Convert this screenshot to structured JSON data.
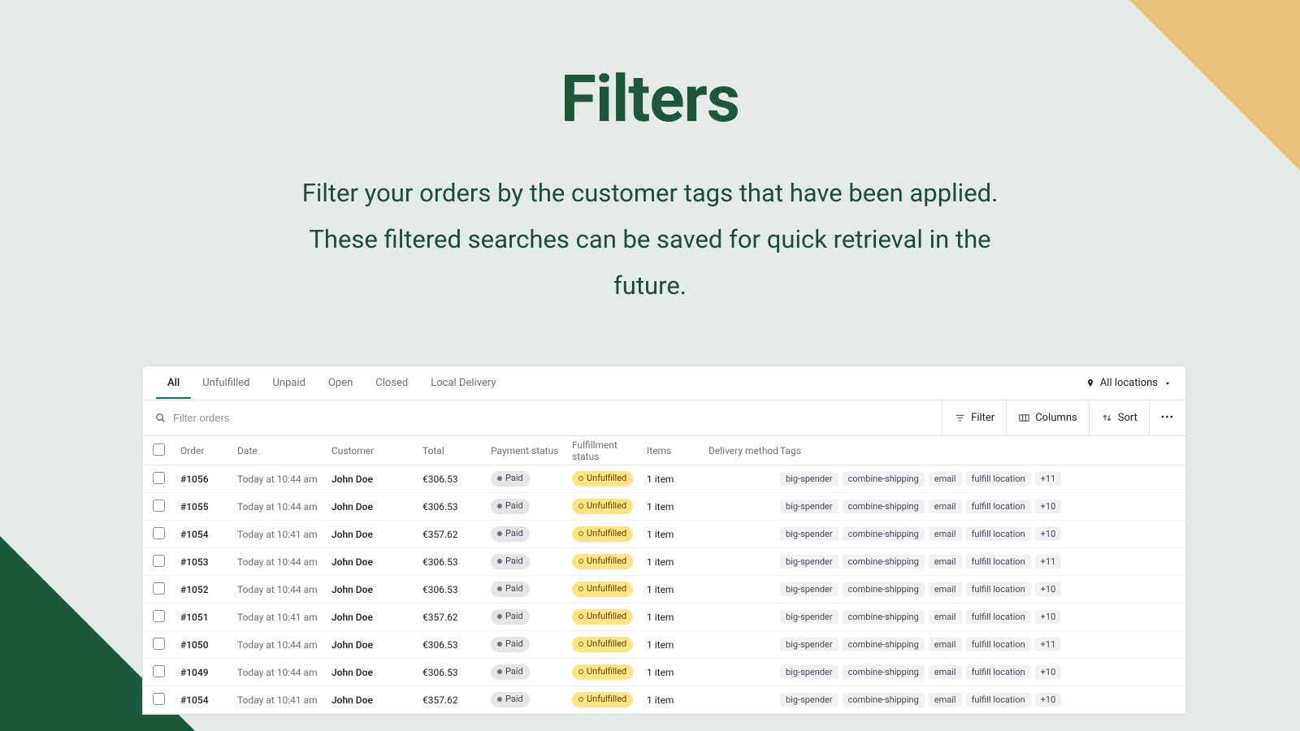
{
  "hero": {
    "title": "Filters",
    "subtitle": "Filter your orders by the customer tags that have been applied. These filtered searches can be saved for quick retrieval in the future."
  },
  "tabs": [
    {
      "label": "All",
      "active": true
    },
    {
      "label": "Unfulfilled",
      "active": false
    },
    {
      "label": "Unpaid",
      "active": false
    },
    {
      "label": "Open",
      "active": false
    },
    {
      "label": "Closed",
      "active": false
    },
    {
      "label": "Local Delivery",
      "active": false
    }
  ],
  "location_selector": {
    "label": "All locations"
  },
  "search": {
    "placeholder": "Filter orders"
  },
  "toolbar": {
    "filter": "Filter",
    "columns": "Columns",
    "sort": "Sort",
    "more": "•••"
  },
  "columns": {
    "order": "Order",
    "date": "Date",
    "customer": "Customer",
    "total": "Total",
    "payment_status": "Payment status",
    "fulfillment_status": "Fulfillment status",
    "items": "Items",
    "delivery_method": "Delivery method",
    "tags": "Tags"
  },
  "tag_labels": {
    "big_spender": "big-spender",
    "combine_shipping": "combine-shipping",
    "email": "email",
    "fulfill_location": "fulfill location"
  },
  "rows": [
    {
      "id": "#1056",
      "date": "Today at 10:44 am",
      "customer": "John Doe",
      "total": "€306.53",
      "payment": "Paid",
      "fulfillment": "Unfulfilled",
      "items": "1 item",
      "delivery": "",
      "extra": "+11"
    },
    {
      "id": "#1055",
      "date": "Today at 10:44 am",
      "customer": "John Doe",
      "total": "€306.53",
      "payment": "Paid",
      "fulfillment": "Unfulfilled",
      "items": "1 item",
      "delivery": "",
      "extra": "+10"
    },
    {
      "id": "#1054",
      "date": "Today at 10:41 am",
      "customer": "John Doe",
      "total": "€357.62",
      "payment": "Paid",
      "fulfillment": "Unfulfilled",
      "items": "1 item",
      "delivery": "",
      "extra": "+10"
    },
    {
      "id": "#1053",
      "date": "Today at 10:44 am",
      "customer": "John Doe",
      "total": "€306.53",
      "payment": "Paid",
      "fulfillment": "Unfulfilled",
      "items": "1 item",
      "delivery": "",
      "extra": "+11"
    },
    {
      "id": "#1052",
      "date": "Today at 10:44 am",
      "customer": "John Doe",
      "total": "€306.53",
      "payment": "Paid",
      "fulfillment": "Unfulfilled",
      "items": "1 item",
      "delivery": "",
      "extra": "+10"
    },
    {
      "id": "#1051",
      "date": "Today at 10:41 am",
      "customer": "John Doe",
      "total": "€357.62",
      "payment": "Paid",
      "fulfillment": "Unfulfilled",
      "items": "1 item",
      "delivery": "",
      "extra": "+10"
    },
    {
      "id": "#1050",
      "date": "Today at 10:44 am",
      "customer": "John Doe",
      "total": "€306.53",
      "payment": "Paid",
      "fulfillment": "Unfulfilled",
      "items": "1 item",
      "delivery": "",
      "extra": "+11"
    },
    {
      "id": "#1049",
      "date": "Today at 10:44 am",
      "customer": "John Doe",
      "total": "€306.53",
      "payment": "Paid",
      "fulfillment": "Unfulfilled",
      "items": "1 item",
      "delivery": "",
      "extra": "+10"
    },
    {
      "id": "#1054",
      "date": "Today at 10:41 am",
      "customer": "John Doe",
      "total": "€357.62",
      "payment": "Paid",
      "fulfillment": "Unfulfilled",
      "items": "1 item",
      "delivery": "",
      "extra": "+10"
    }
  ]
}
